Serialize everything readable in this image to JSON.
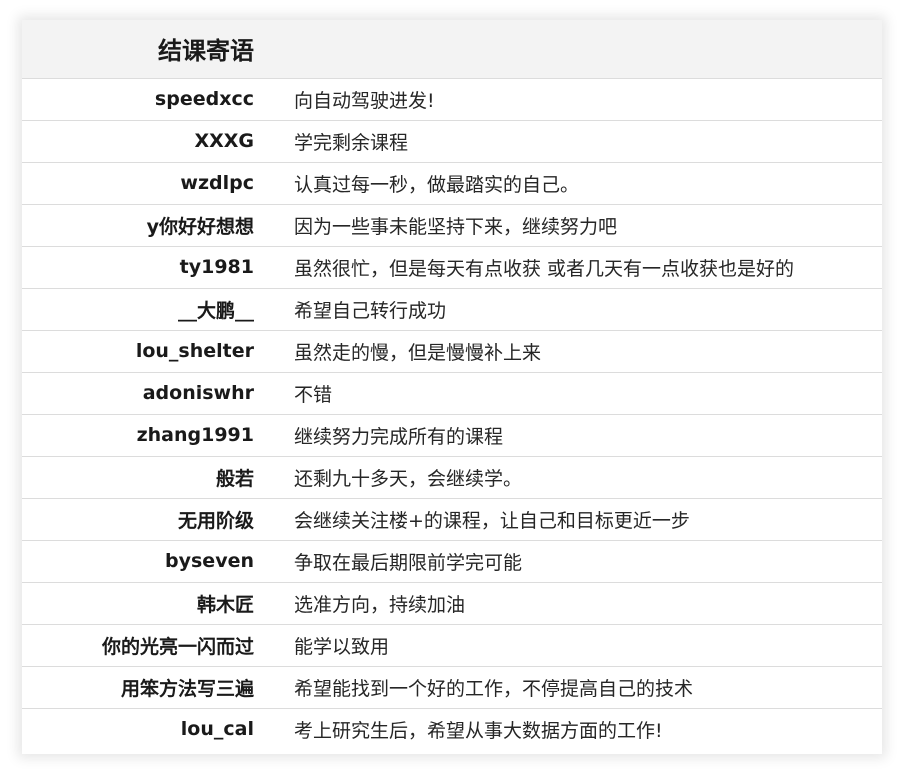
{
  "table": {
    "header": [
      "结课寄语",
      ""
    ],
    "rows": [
      {
        "name": "speedxcc",
        "message": "向自动驾驶进发!"
      },
      {
        "name": "XXXG",
        "message": "学完剩余课程"
      },
      {
        "name": "wzdlpc",
        "message": "认真过每一秒，做最踏实的自己。"
      },
      {
        "name": "y你好好想想",
        "message": "因为一些事未能坚持下来，继续努力吧"
      },
      {
        "name": "ty1981",
        "message": "虽然很忙，但是每天有点收获 或者几天有一点收获也是好的"
      },
      {
        "name": "__大鹏__",
        "message": "希望自己转行成功"
      },
      {
        "name": "lou_shelter",
        "message": "虽然走的慢，但是慢慢补上来"
      },
      {
        "name": "adoniswhr",
        "message": "不错"
      },
      {
        "name": "zhang1991",
        "message": "继续努力完成所有的课程"
      },
      {
        "name": "般若",
        "message": "还剩九十多天，会继续学。"
      },
      {
        "name": "无用阶级",
        "message": "会继续关注楼+的课程，让自己和目标更近一步"
      },
      {
        "name": "byseven",
        "message": "争取在最后期限前学完可能"
      },
      {
        "name": "韩木匠",
        "message": "选准方向，持续加油"
      },
      {
        "name": "你的光亮一闪而过",
        "message": "能学以致用"
      },
      {
        "name": "用笨方法写三遍",
        "message": "希望能找到一个好的工作，不停提高自己的技术"
      },
      {
        "name": "lou_cal",
        "message": "考上研究生后，希望从事大数据方面的工作!"
      }
    ]
  }
}
